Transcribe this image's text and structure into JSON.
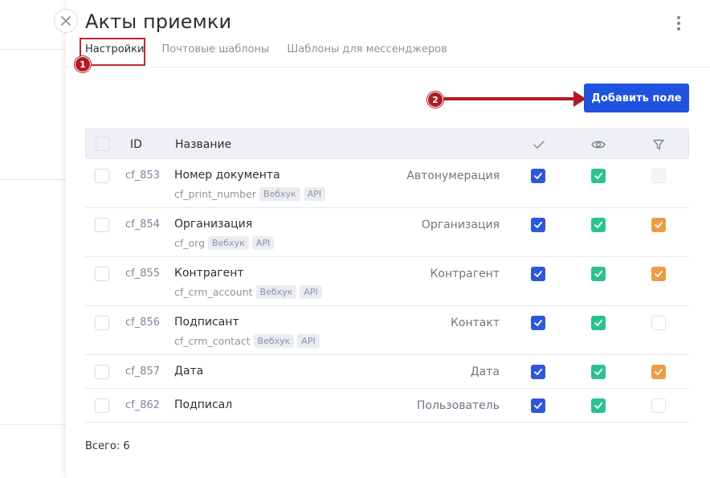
{
  "window": {
    "title": "Акты приемки"
  },
  "tabs": [
    {
      "label": "Настройки",
      "active": true
    },
    {
      "label": "Почтовые шаблоны",
      "active": false
    },
    {
      "label": "Шаблоны для мессенджеров",
      "active": false
    }
  ],
  "annotations": {
    "marker1": "1",
    "marker2": "2"
  },
  "toolbar": {
    "add_field_label": "Добавить поле"
  },
  "table": {
    "columns": {
      "id": "ID",
      "name": "Название",
      "col_required_icon": "check-icon",
      "col_visible_icon": "eye-icon",
      "col_filter_icon": "filter-icon"
    },
    "rows": [
      {
        "id": "cf_853",
        "name": "Номер документа",
        "code": "cf_print_number",
        "tags": [
          "Вебхук",
          "API"
        ],
        "type": "Автонумерация",
        "required": true,
        "visible": true,
        "filter": "disabled"
      },
      {
        "id": "cf_854",
        "name": "Организация",
        "code": "cf_org",
        "tags": [
          "Вебхук",
          "API"
        ],
        "type": "Организация",
        "required": true,
        "visible": true,
        "filter": "on"
      },
      {
        "id": "cf_855",
        "name": "Контрагент",
        "code": "cf_crm_account",
        "tags": [
          "Вебхук",
          "API"
        ],
        "type": "Контрагент",
        "required": true,
        "visible": true,
        "filter": "on"
      },
      {
        "id": "cf_856",
        "name": "Подписант",
        "code": "cf_crm_contact",
        "tags": [
          "Вебхук",
          "API"
        ],
        "type": "Контакт",
        "required": true,
        "visible": true,
        "filter": "off"
      },
      {
        "id": "cf_857",
        "name": "Дата",
        "code": "",
        "tags": [],
        "type": "Дата",
        "required": true,
        "visible": true,
        "filter": "on"
      },
      {
        "id": "cf_862",
        "name": "Подписал",
        "code": "",
        "tags": [],
        "type": "Пользователь",
        "required": true,
        "visible": true,
        "filter": "off"
      }
    ]
  },
  "footer": {
    "total": "Всего: 6"
  },
  "colors": {
    "accent": "#1f52e0",
    "annotation": "#b01c22",
    "check_blue": "#2f57d9",
    "check_green": "#2bc28f",
    "check_orange": "#ee9b44"
  }
}
